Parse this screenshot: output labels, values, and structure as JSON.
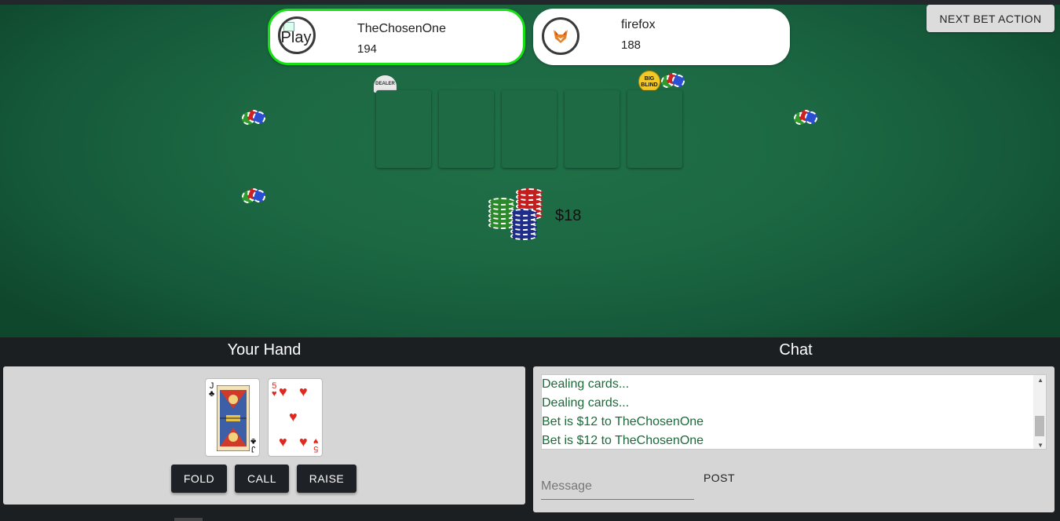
{
  "top_action": {
    "label": "NEXT BET ACTION"
  },
  "players": [
    {
      "name": "TheChosenOne",
      "stack": "194",
      "avatar_alt": "Play",
      "active": true
    },
    {
      "name": "firefox",
      "stack": "188",
      "avatar_icon": "fox-icon",
      "active": false
    }
  ],
  "table": {
    "dealer_label": "DEALER",
    "blind_label_1": "BIG",
    "blind_label_2": "BLIND",
    "pot": "$18"
  },
  "hand": {
    "title": "Your Hand",
    "cards": [
      {
        "rank": "J",
        "suit": "♣",
        "color": "#111111"
      },
      {
        "rank": "5",
        "suit": "♥",
        "color": "#e0281e"
      }
    ],
    "actions": {
      "fold": "FOLD",
      "call": "CALL",
      "raise": "RAISE"
    }
  },
  "chat": {
    "title": "Chat",
    "messages": [
      "Dealing cards...",
      "Dealing cards...",
      "Bet is $12 to TheChosenOne",
      "Bet is $12 to TheChosenOne"
    ],
    "input_placeholder": "Message",
    "post_label": "POST"
  },
  "colors": {
    "felt": "#1c6843",
    "active_border": "#17e014",
    "chat_text": "#1c6a3a",
    "button_dark": "#1e2125"
  }
}
